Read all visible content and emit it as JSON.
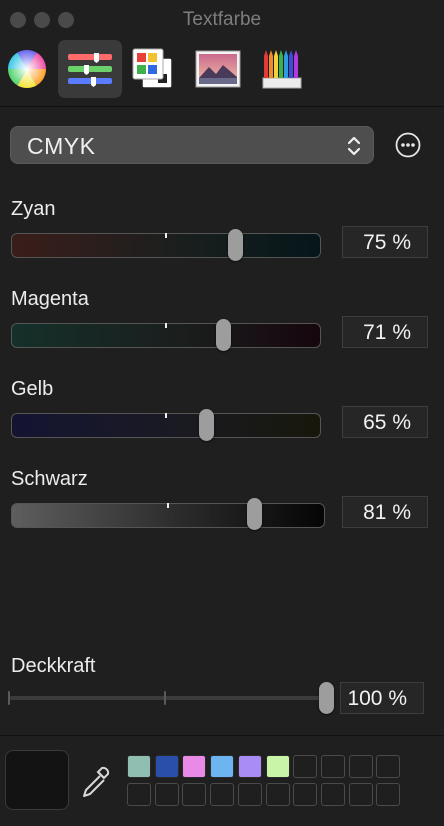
{
  "window": {
    "title": "Textfarbe"
  },
  "toolbar": {
    "items": [
      {
        "icon": "color-wheel-icon",
        "selected": false
      },
      {
        "icon": "sliders-icon",
        "selected": true
      },
      {
        "icon": "color-palettes-icon",
        "selected": false
      },
      {
        "icon": "image-palette-icon",
        "selected": false
      },
      {
        "icon": "pencils-icon",
        "selected": false
      }
    ]
  },
  "mode_select": {
    "value": "CMYK"
  },
  "sliders": [
    {
      "label": "Zyan",
      "value": "75 %",
      "level": 0.75
    },
    {
      "label": "Magenta",
      "value": "71 %",
      "level": 0.71
    },
    {
      "label": "Gelb",
      "value": "65 %",
      "level": 0.65
    },
    {
      "label": "Schwarz",
      "value": "81 %",
      "level": 0.81
    }
  ],
  "opacity": {
    "label": "Deckkraft",
    "value": "100 %",
    "level": 1.0
  },
  "current_color": "#131313",
  "swatches": [
    "#8fbfb0",
    "#2a4faa",
    "#e98ae6",
    "#6cb5f0",
    "#a98cf5",
    "#c9f5a8"
  ]
}
